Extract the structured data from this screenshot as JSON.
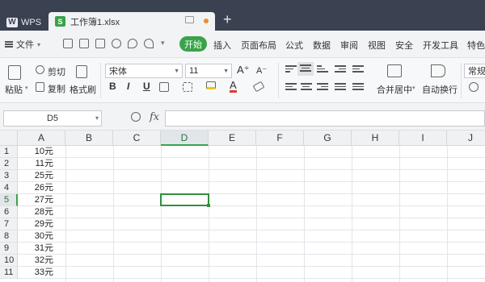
{
  "tabs": {
    "app": "WPS",
    "doc": "工作簿1.xlsx",
    "doc_icon": "S"
  },
  "menu": {
    "file": "文件",
    "start": "开始",
    "items": [
      "插入",
      "页面布局",
      "公式",
      "数据",
      "审阅",
      "视图",
      "安全",
      "开发工具",
      "特色应"
    ]
  },
  "ribbon": {
    "paste": "粘贴",
    "cut": "剪切",
    "copy": "复制",
    "format_painter": "格式刷",
    "font_name": "宋体",
    "font_size": "11",
    "merge": "合并居中",
    "wrap": "自动换行",
    "number_format": "常规"
  },
  "formula_bar": {
    "name_box": "D5",
    "fx": "fx",
    "value": ""
  },
  "grid": {
    "columns": [
      "A",
      "B",
      "C",
      "D",
      "E",
      "F",
      "G",
      "H",
      "I",
      "J"
    ],
    "rows": [
      "1",
      "2",
      "3",
      "4",
      "5",
      "6",
      "7",
      "8",
      "9",
      "10",
      "11"
    ],
    "selected_cell": "D5",
    "col_a": [
      "10元",
      "11元",
      "25元",
      "26元",
      "27元",
      "28元",
      "29元",
      "30元",
      "31元",
      "32元",
      "33元"
    ]
  },
  "colors": {
    "accent": "#3aa34a",
    "tabbar": "#3a4150"
  }
}
